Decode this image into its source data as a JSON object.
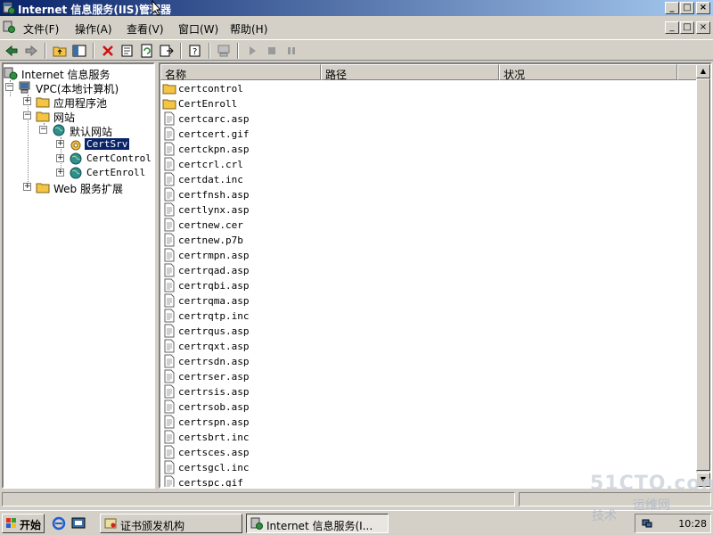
{
  "window": {
    "title": "Internet 信息服务(IIS)管理器",
    "minimize": "_",
    "maximize": "□",
    "close": "×"
  },
  "menu": {
    "items": [
      "文件(F)",
      "操作(A)",
      "查看(V)",
      "窗口(W)",
      "帮助(H)"
    ]
  },
  "tree": {
    "root": "Internet 信息服务",
    "computer": "VPC(本地计算机)",
    "app_pools": "应用程序池",
    "websites": "网站",
    "default_site": "默认网站",
    "certsrv": "CertSrv",
    "certcontrol": "CertControl",
    "certenroll": "CertEnroll",
    "web_ext": "Web 服务扩展"
  },
  "list": {
    "columns": [
      "名称",
      "路径",
      "状况"
    ],
    "rows": [
      {
        "name": "certcontrol",
        "type": "folder"
      },
      {
        "name": "CertEnroll",
        "type": "folder"
      },
      {
        "name": "certcarc.asp",
        "type": "file"
      },
      {
        "name": "certcert.gif",
        "type": "file"
      },
      {
        "name": "certckpn.asp",
        "type": "file"
      },
      {
        "name": "certcrl.crl",
        "type": "file"
      },
      {
        "name": "certdat.inc",
        "type": "file"
      },
      {
        "name": "certfnsh.asp",
        "type": "file"
      },
      {
        "name": "certlynx.asp",
        "type": "file"
      },
      {
        "name": "certnew.cer",
        "type": "file"
      },
      {
        "name": "certnew.p7b",
        "type": "file"
      },
      {
        "name": "certrmpn.asp",
        "type": "file"
      },
      {
        "name": "certrqad.asp",
        "type": "file"
      },
      {
        "name": "certrqbi.asp",
        "type": "file"
      },
      {
        "name": "certrqma.asp",
        "type": "file"
      },
      {
        "name": "certrqtp.inc",
        "type": "file"
      },
      {
        "name": "certrqus.asp",
        "type": "file"
      },
      {
        "name": "certrqxt.asp",
        "type": "file"
      },
      {
        "name": "certrsdn.asp",
        "type": "file"
      },
      {
        "name": "certrser.asp",
        "type": "file"
      },
      {
        "name": "certrsis.asp",
        "type": "file"
      },
      {
        "name": "certrsob.asp",
        "type": "file"
      },
      {
        "name": "certrspn.asp",
        "type": "file"
      },
      {
        "name": "certsbrt.inc",
        "type": "file"
      },
      {
        "name": "certsces.asp",
        "type": "file"
      },
      {
        "name": "certsgcl.inc",
        "type": "file"
      },
      {
        "name": "certspc.gif",
        "type": "file"
      }
    ]
  },
  "taskbar": {
    "start": "开始",
    "tasks": [
      "证书颁发机构",
      "Internet 信息服务(I..."
    ],
    "clock": "10:28"
  },
  "watermark": {
    "brand": "51CTO.com",
    "line1": "运维网",
    "line2": "技术"
  },
  "colors": {
    "title_active": "#0a246a",
    "face": "#d4d0c8",
    "selection": "#0a246a",
    "folder": "#f4c542"
  }
}
